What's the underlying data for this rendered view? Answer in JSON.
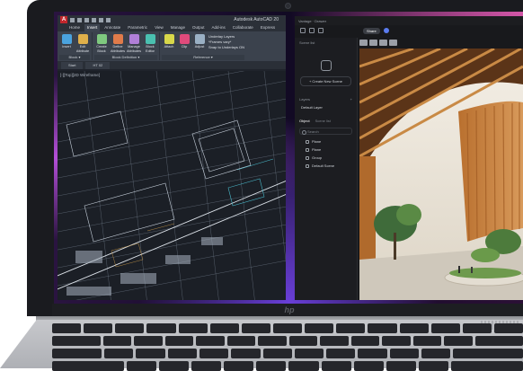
{
  "acad": {
    "title": "Autodesk AutoCAD 20",
    "tabs": [
      "Home",
      "Insert",
      "Annotate",
      "Parametric",
      "View",
      "Manage",
      "Output",
      "Add-ins",
      "Collaborate",
      "Express"
    ],
    "active_tab": "Insert",
    "tools_block": [
      {
        "label": "Insert"
      },
      {
        "label": "Edit Attribute"
      }
    ],
    "tools_blockdef": [
      {
        "label": "Create Block"
      },
      {
        "label": "Define Attributes"
      },
      {
        "label": "Manage Attributes"
      },
      {
        "label": "Block Editor"
      }
    ],
    "tools_reference": [
      {
        "label": "Attach"
      },
      {
        "label": "Clip"
      },
      {
        "label": "Adjust"
      }
    ],
    "reference_list": [
      "Underlay Layers",
      "*Frames vary*",
      "Snap to Underlays ON"
    ],
    "panel_titles": {
      "block": "Block ▾",
      "blockdef": "Block Definition ▾",
      "reference": "Reference ▾"
    },
    "file_tabs": [
      "Start",
      "HT 02"
    ],
    "viewport_label": "[-][Top][2D Wireframe]",
    "colors": {
      "logo": "#c1272d",
      "active_tab": "#3d4450"
    }
  },
  "app": {
    "header": "Vantage · Drawer",
    "share_label": "Share",
    "scenes_header": "Scene list",
    "create_scene_label": "+ Create New Scene",
    "layers_header": "Layers",
    "default_layer": "Default Layer",
    "object_tabs": {
      "active": "Object",
      "inactive": "Scene list"
    },
    "search_placeholder": "Search",
    "objects": [
      "Plane",
      "Plane",
      "Group",
      "Default Scene"
    ]
  },
  "laptop": {
    "brand_logo": "hp"
  }
}
